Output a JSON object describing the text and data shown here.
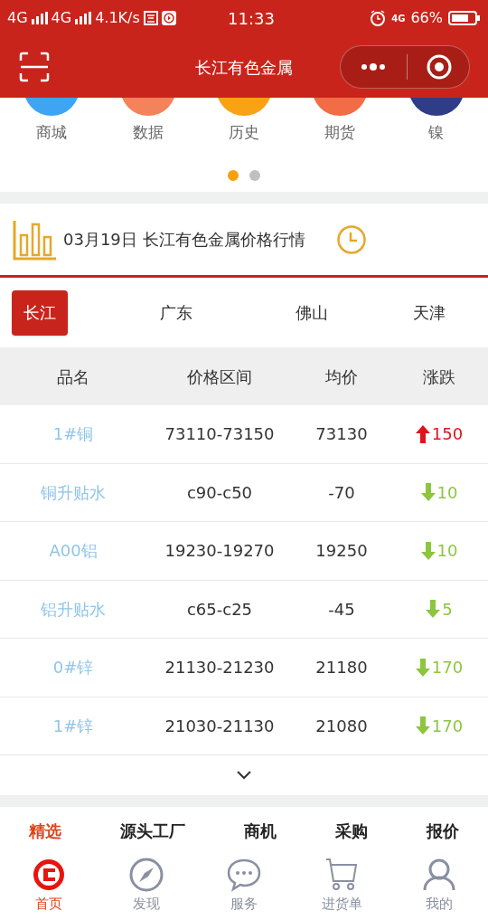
{
  "status_bar": {
    "left": [
      "4G",
      "4G",
      "4.1K/s"
    ],
    "time": "11:33",
    "network": "4G",
    "battery": "66%"
  },
  "nav": {
    "title": "长江有色金属"
  },
  "shortcuts": [
    {
      "label": "商城",
      "color": "#3da5f4"
    },
    {
      "label": "数据",
      "color": "#f4825a"
    },
    {
      "label": "历史",
      "color": "#f8a214"
    },
    {
      "label": "期货",
      "color": "#f26c45"
    },
    {
      "label": "镍",
      "color": "#2e3d86"
    }
  ],
  "pager": [
    {
      "selected": true
    },
    {
      "selected": false
    }
  ],
  "header": {
    "title": "03月19日  长江有色金属价格行情"
  },
  "regions": [
    {
      "label": "长江",
      "selected": true
    },
    {
      "label": "广东",
      "selected": false
    },
    {
      "label": "佛山",
      "selected": false
    },
    {
      "label": "天津",
      "selected": false
    }
  ],
  "table": {
    "columns": [
      "品名",
      "价格区间",
      "均价",
      "涨跌"
    ],
    "rows": [
      {
        "name": "1#铜",
        "range": "73110-73150",
        "avg": "73130",
        "change": "150",
        "kind": "up"
      },
      {
        "name": "铜升贴水",
        "range": "c90-c50",
        "avg": "-70",
        "change": "10",
        "kind": "down"
      },
      {
        "name": "A00铝",
        "range": "19230-19270",
        "avg": "19250",
        "change": "10",
        "kind": "down"
      },
      {
        "name": "铝升贴水",
        "range": "c65-c25",
        "avg": "-45",
        "change": "5",
        "kind": "down"
      },
      {
        "name": "0#锌",
        "range": "21130-21230",
        "avg": "21180",
        "change": "170",
        "kind": "down"
      },
      {
        "name": "1#锌",
        "range": "21030-21130",
        "avg": "21080",
        "change": "170",
        "kind": "down"
      }
    ]
  },
  "categories": [
    {
      "label": "精选",
      "selected": true
    },
    {
      "label": "源头工厂",
      "selected": false
    },
    {
      "label": "商机",
      "selected": false
    },
    {
      "label": "采购",
      "selected": false
    },
    {
      "label": "报价",
      "selected": false
    }
  ],
  "tab_bar": [
    {
      "label": "首页",
      "kind": "home",
      "selected": true
    },
    {
      "label": "发现",
      "kind": "compass",
      "selected": false
    },
    {
      "label": "服务",
      "kind": "chat",
      "selected": false
    },
    {
      "label": "进货单",
      "kind": "cart",
      "selected": false
    },
    {
      "label": "我的",
      "kind": "user",
      "selected": false
    }
  ]
}
